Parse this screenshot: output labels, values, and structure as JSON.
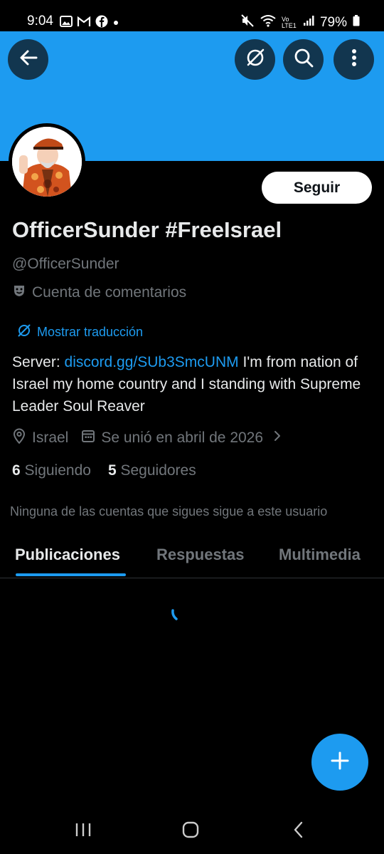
{
  "status_bar": {
    "time": "9:04",
    "battery": "79%",
    "left_icons": [
      "image-icon",
      "gmail-icon",
      "facebook-icon",
      "dot-icon"
    ],
    "right_icons": [
      "mute-icon",
      "wifi-icon",
      "volte-icon",
      "signal-icon",
      "battery-icon"
    ],
    "network_label": "Vo LTE1"
  },
  "header": {
    "banner_color": "#1d9bf0",
    "buttons": [
      "back-icon",
      "translate-icon",
      "search-icon",
      "more-icon"
    ]
  },
  "profile": {
    "follow_label": "Seguir",
    "display_name": "OfficerSunder #FreeIsrael",
    "handle": "@OfficerSunder",
    "category": "Cuenta de comentarios",
    "translate_label": "Mostrar traducción",
    "bio_prefix": "Server: ",
    "bio_link": "discord.gg/SUb3SmcUNM",
    "bio_text": " I'm from nation of Israel my home country and I standing with Supreme Leader Soul Reaver",
    "location": "Israel",
    "joined": "Se unió en abril de 2026",
    "following_count": "6",
    "following_label": "Siguiendo",
    "followers_count": "5",
    "followers_label": "Seguidores",
    "no_mutual_text": "Ninguna de las cuentas que sigues sigue a este usuario"
  },
  "tabs": [
    {
      "label": "Publicaciones",
      "active": true
    },
    {
      "label": "Respuestas",
      "active": false
    },
    {
      "label": "Multimedia",
      "active": false
    }
  ],
  "fab": {
    "icon": "plus-icon"
  },
  "nav_bar": {
    "buttons": [
      "recents-icon",
      "home-icon",
      "back-nav-icon"
    ]
  },
  "colors": {
    "accent": "#1d9bf0",
    "background": "#000000",
    "muted": "#71767b",
    "text": "#e7e9ea"
  }
}
